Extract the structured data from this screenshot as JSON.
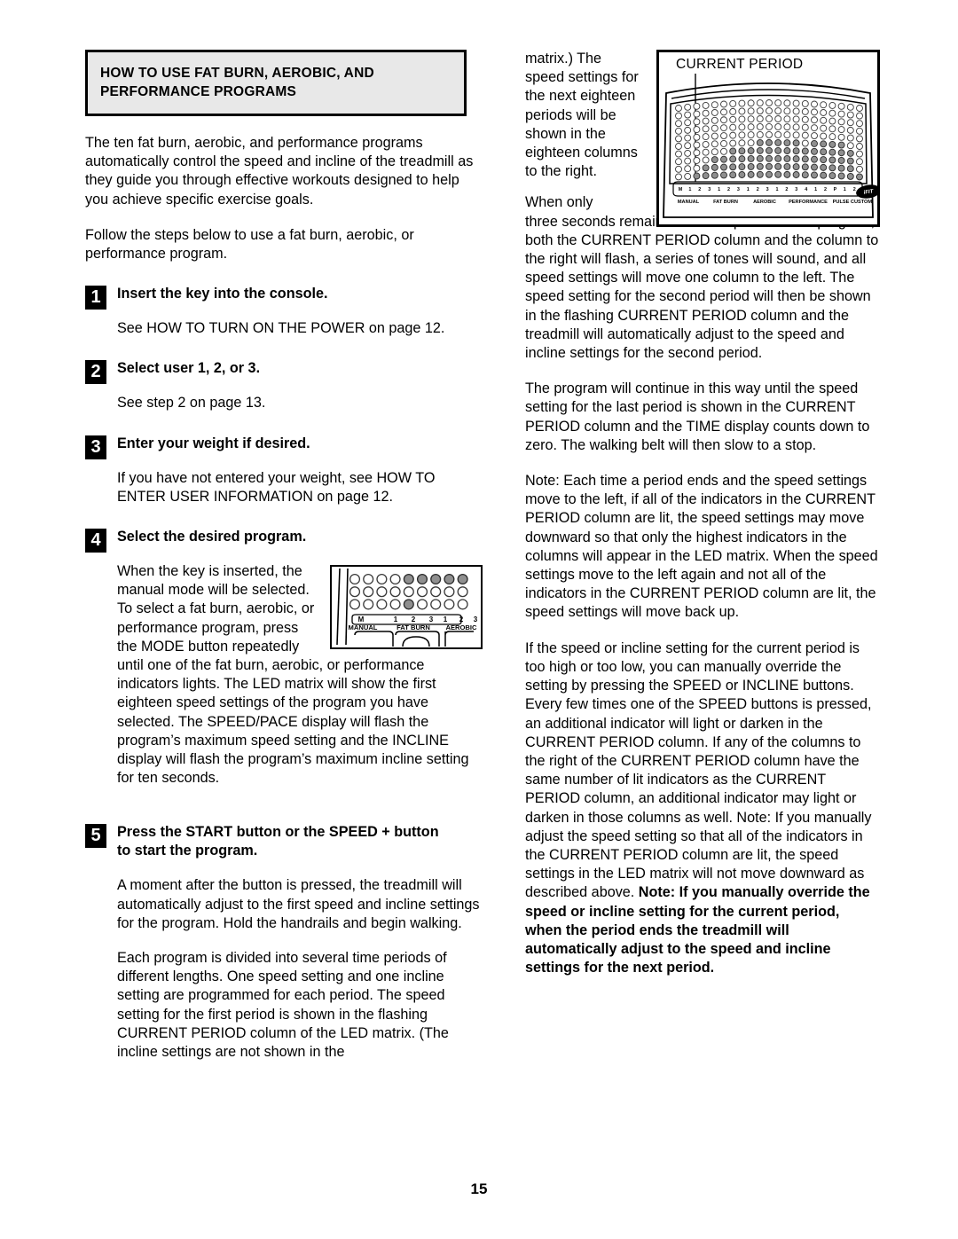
{
  "page": {
    "number": "15"
  },
  "heading": {
    "line1": "HOW TO USE FAT BURN, AEROBIC, AND",
    "line2": "PERFORMANCE PROGRAMS"
  },
  "left_column": {
    "intro1": "The ten fat burn, aerobic, and performance programs automatically control the speed and incline of the treadmill as they guide you through effective workouts designed to help you achieve specific exercise goals.",
    "intro2": "Follow the steps below to use a fat burn, aerobic, or performance program.",
    "steps": [
      {
        "number": "1",
        "title": "Insert the key into the console.",
        "body": "See HOW TO TURN ON THE POWER on page 12."
      },
      {
        "number": "2",
        "title": "Select user 1, 2, or 3.",
        "body": "See step 2 on page 13."
      },
      {
        "number": "3",
        "title": "Enter your weight if desired.",
        "body": "If you have not entered your weight, see HOW TO ENTER USER INFORMATION on page 12."
      },
      {
        "number": "4",
        "title": "Select the desired program.",
        "body": "When the key is inserted, the manual mode will be selected. To select a fat burn, aerobic, or performance program, press the MODE button repeatedly until one of the fat burn, aerobic, or performance indicators lights. The LED matrix will show the first eighteen speed settings of the program you have selected. The SPEED/PACE display will flash the program’s maximum speed setting and the INCLINE display will flash the program’s maximum incline setting for ten seconds."
      },
      {
        "number": "5",
        "title_line1": "Press the START button or the SPEED + button",
        "title_line2": "to start the program.",
        "body1": "A moment after the button is pressed, the treadmill will automatically adjust to the first speed and incline settings for the program. Hold the handrails and begin walking.",
        "body2": "Each program is divided into several time periods of different lengths. One speed setting and one incline setting are programmed for each period. The speed setting for the first period is shown in the flashing CURRENT PERIOD column of the LED matrix. (The incline settings are not shown in the"
      }
    ]
  },
  "right_column": {
    "para_wrap_top": "matrix.) The speed settings for the next eighteen periods will be shown in the eighteen columns to the right.",
    "para_when_only": "When only",
    "para1": "three seconds remain in the first period of the program, both the CURRENT PERIOD column and the column to the right will flash, a series of tones will sound, and all speed settings will move one column to the left. The speed setting for the second period will then be shown in the flashing CURRENT PERIOD column and the treadmill will automatically adjust to the speed and incline settings for the second period.",
    "para2": "The program will continue in this way until the speed setting for the last period is shown in the CURRENT PERIOD column and the TIME display counts down to zero. The walking belt will then slow to a stop.",
    "para3": "Note: Each time a period ends and the speed settings move to the left, if all of the indicators in the CURRENT PERIOD column are lit, the speed settings may move downward so that only the highest indicators in the columns will appear in the LED matrix. When the speed settings move to the left again and not all of the indicators in the CURRENT PERIOD column are lit, the speed settings will move back up.",
    "para4_normal": "If the speed or incline setting for the current period is too high or too low, you can manually override the setting by pressing the SPEED or INCLINE buttons. Every few times one of the SPEED buttons is pressed, an additional indicator will light or darken in the CURRENT PERIOD column. If any of the columns to the right of the CURRENT PERIOD column have the same number of lit indicators as the CURRENT PERIOD column, an additional indicator may light or darken in those columns as well. Note: If you manually adjust the speed setting so that all of the indicators in the CURRENT PERIOD column are lit, the speed settings in the LED matrix will not move downward as described above. ",
    "para4_bold": "Note: If you manually override the speed or incline setting for the current period, when the period ends the treadmill will automatically adjust to the speed and incline settings for the next period."
  },
  "figures": {
    "current_period": {
      "title": "CURRENT PERIOD",
      "group_labels": [
        "MANUAL",
        "FAT BURN",
        "AEROBIC",
        "PERFORMANCE",
        "PULSE",
        "CUSTOM"
      ],
      "key_labels": [
        "M",
        "1",
        "2",
        "3",
        "1",
        "2",
        "3",
        "1",
        "2",
        "3",
        "1",
        "2",
        "3",
        "4",
        "1",
        "2",
        "P",
        "1",
        "2"
      ],
      "brand": "iFIT.com",
      "columns": 21,
      "rows": 10,
      "column_heights": [
        0,
        0,
        1,
        2,
        3,
        3,
        4,
        4,
        4,
        5,
        5,
        5,
        5,
        5,
        4,
        5,
        5,
        5,
        5,
        4,
        1
      ]
    },
    "console_small": {
      "group_labels": [
        "MANUAL",
        "FAT BURN",
        "AEROBIC"
      ],
      "key_labels": [
        "M",
        "1",
        "2",
        "3",
        "1",
        "2",
        "3"
      ],
      "columns": 9,
      "rows": 3,
      "lit_top_from": 4,
      "lit_bottom_index": 4
    }
  }
}
